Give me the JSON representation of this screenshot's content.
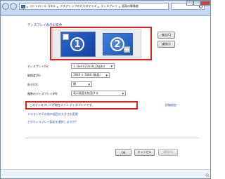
{
  "address_bar": {
    "crumbs": [
      "コントロール パネル",
      "デスクトップのカスタマイズ",
      "ディスプレイ",
      "画面の解像度"
    ]
  },
  "section_title": "ディスプレイ表示の変更",
  "monitors": [
    {
      "number": "1"
    },
    {
      "number": "2"
    }
  ],
  "buttons": {
    "detect": "検出(C)",
    "identify": "識別(I)",
    "ok": "OK",
    "cancel": "キャンセル",
    "apply": "適用(A)"
  },
  "form": {
    "display_label": "ディスプレイ(S):",
    "display_value": "1. Dell E2311H_Digital",
    "resolution_label": "解像度(R):",
    "resolution_value": "1920 × 1080 (推奨)",
    "orientation_label": "向き(O):",
    "orientation_value": "横",
    "multi_label": "複数のディスプレイ(M):",
    "multi_value": "表示画面を拡張する"
  },
  "notice": "このディスプレイが現在メイン ディスプレイです。",
  "links": {
    "advanced": "詳細設定",
    "text_size": "テキストやその他の項目の大きさの変更",
    "which_setting": "どのディスプレイ設定を選択しますか?"
  },
  "colors": {
    "highlight": "#e02020",
    "link": "#1f51b8",
    "monitor": "#2058b7"
  }
}
